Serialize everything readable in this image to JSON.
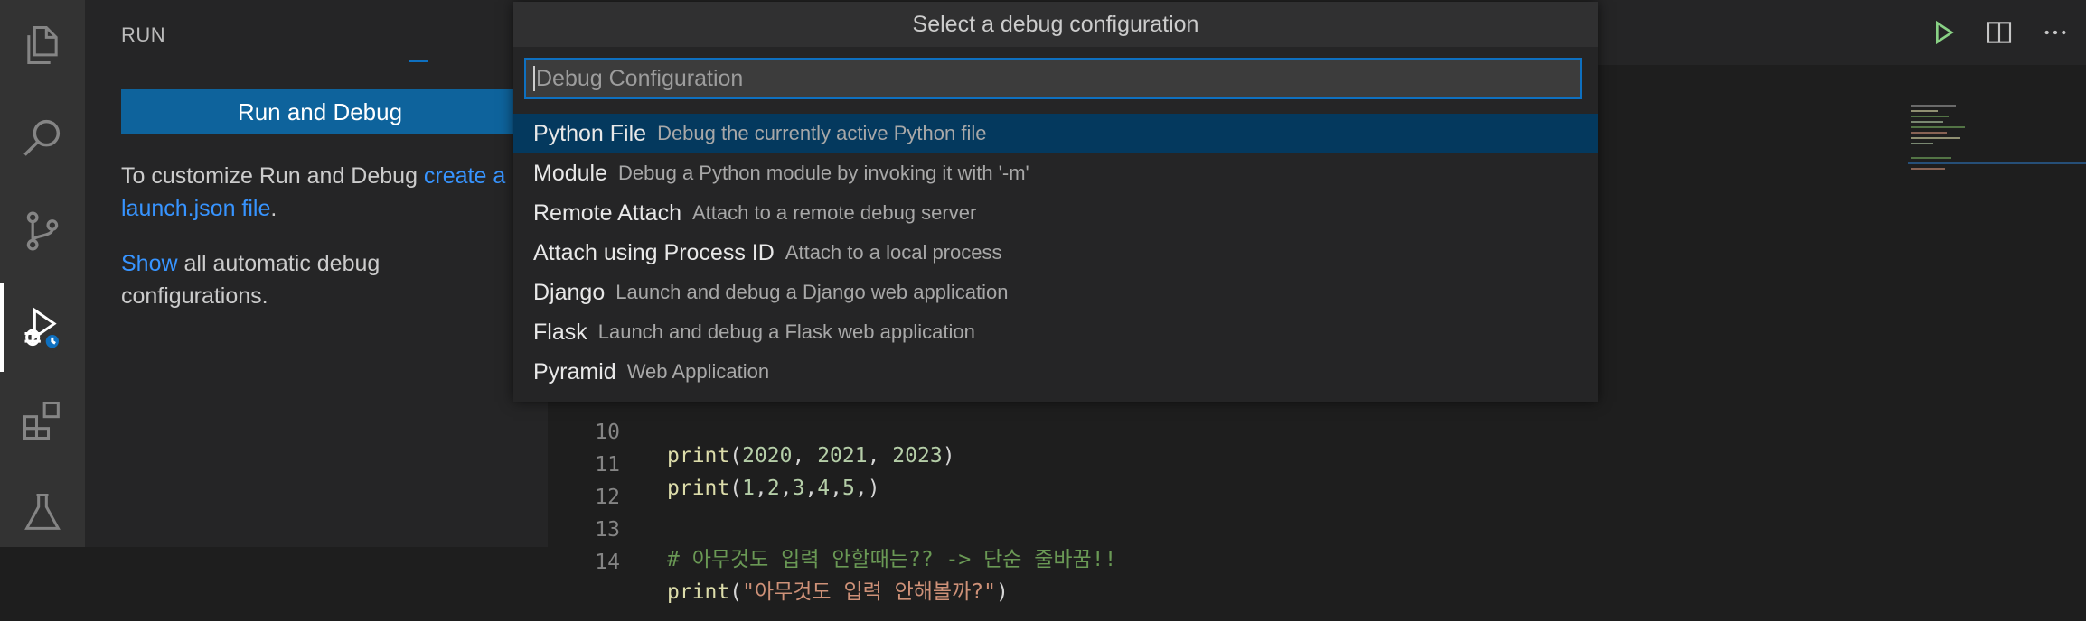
{
  "activity_bar": {
    "items": [
      "explorer-icon",
      "search-icon",
      "source-control-icon",
      "run-debug-icon",
      "extensions-icon",
      "testing-icon"
    ]
  },
  "sidebar": {
    "title": "RUN",
    "run_button": "Run and Debug",
    "customize_text": "To customize Run and Debug ",
    "customize_link": "create a launch.json file",
    "customize_period": ".",
    "show_link": "Show",
    "show_text": " all automatic debug configurations."
  },
  "quick_pick": {
    "title": "Select a debug configuration",
    "placeholder": "Debug Configuration",
    "items": [
      {
        "label": "Python File",
        "description": "Debug the currently active Python file"
      },
      {
        "label": "Module",
        "description": "Debug a Python module by invoking it with '-m'"
      },
      {
        "label": "Remote Attach",
        "description": "Attach to a remote debug server"
      },
      {
        "label": "Attach using Process ID",
        "description": "Attach to a local process"
      },
      {
        "label": "Django",
        "description": "Launch and debug a Django web application"
      },
      {
        "label": "Flask",
        "description": "Launch and debug a Flask web application"
      },
      {
        "label": "Pyramid",
        "description": "Web Application"
      }
    ]
  },
  "editor": {
    "lines": [
      {
        "number": "10",
        "text": "print(2020, 2021, 2023)"
      },
      {
        "number": "11",
        "text": "print(1,2,3,4,5,)"
      },
      {
        "number": "12",
        "text": ""
      },
      {
        "number": "13",
        "text": "# 아무것도 입력 안할때는?? -> 단순 줄바꿈!!"
      },
      {
        "number": "14",
        "text": "print(\"아무것도 입력 안해볼까?\")"
      }
    ],
    "colors": {
      "function": "#dcdcaa",
      "number": "#b5cea8",
      "comment": "#6a9955",
      "string": "#ce9178"
    }
  }
}
